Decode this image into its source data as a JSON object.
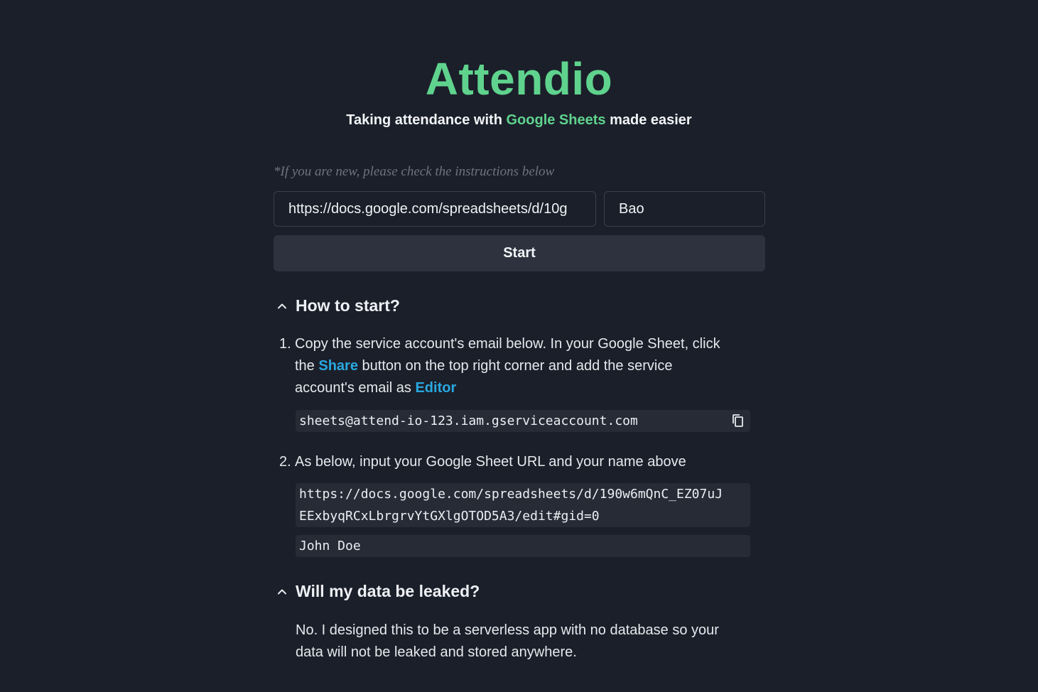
{
  "app": {
    "title": "Attendio",
    "subtitle_prefix": "Taking attendance with ",
    "subtitle_accent": "Google Sheets",
    "subtitle_suffix": " made easier"
  },
  "form": {
    "hint": "*If you are new, please check the instructions below",
    "url_value": "https://docs.google.com/spreadsheets/d/10g",
    "name_value": "Bao",
    "start_label": "Start"
  },
  "faq": {
    "how_to_start": {
      "heading": "How to start?",
      "step1": {
        "number": "1.",
        "line1": "Copy the service account's email below. In your Google Sheet, click",
        "line2_prefix": "the ",
        "share": "Share",
        "line2_suffix": " button on the top right corner and add the service",
        "line3_prefix": "account's email as ",
        "editor": "Editor",
        "email": "sheets@attend-io-123.iam.gserviceaccount.com"
      },
      "step2": {
        "number": "2.",
        "text": "As below, input your Google Sheet URL and your name above",
        "example_url_line1": "https://docs.google.com/spreadsheets/d/190w6mQnC_EZ07uJ",
        "example_url_line2": "EExbyqRCxLbrgrvYtGXlgOTOD5A3/edit#gid=0",
        "example_name": "John Doe"
      }
    },
    "data_leak": {
      "heading": "Will my data be leaked?",
      "answer_line1": "No. I designed this to be a serverless app with no database so your",
      "answer_line2": "data will not be leaked and stored anywhere."
    }
  },
  "colors": {
    "background": "#1b1f2a",
    "brand": "#5fd38d",
    "link": "#29a8e0"
  },
  "icons": {
    "chevron": "chevron-up-icon",
    "copy": "copy-icon"
  }
}
